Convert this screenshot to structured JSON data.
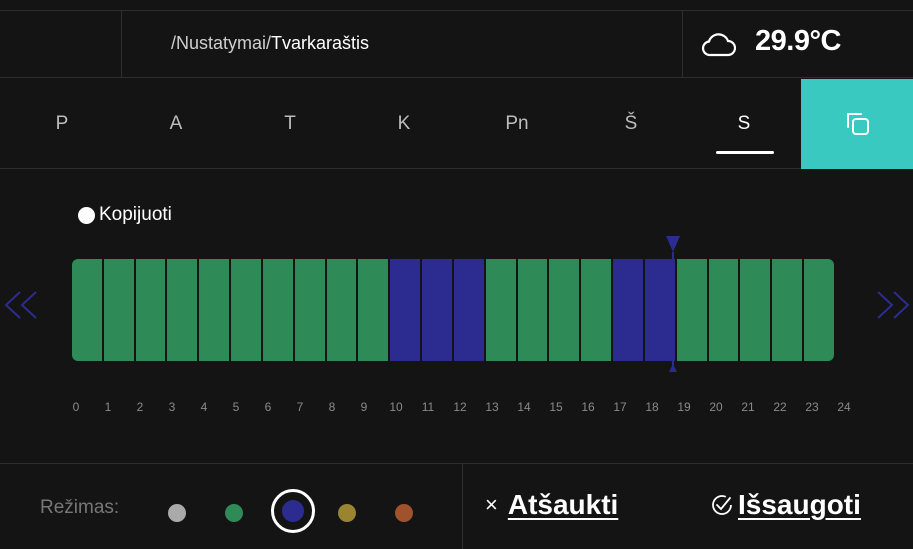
{
  "header": {
    "breadcrumb_path": "/Nustatymai/",
    "breadcrumb_current": "Tvarkaraštis",
    "weather_icon": "cloud-icon",
    "temperature": "29.9°C"
  },
  "days": {
    "items": [
      "P",
      "A",
      "T",
      "K",
      "Pn",
      "Š",
      "S"
    ],
    "active": "S",
    "copy_icon": "copy-icon",
    "copy_color": "#39c9c0"
  },
  "copy_option": {
    "label": "Kopijuoti"
  },
  "schedule": {
    "hours": [
      "0",
      "1",
      "2",
      "3",
      "4",
      "5",
      "6",
      "7",
      "8",
      "9",
      "10",
      "11",
      "12",
      "13",
      "14",
      "15",
      "16",
      "17",
      "18",
      "19",
      "20",
      "21",
      "22",
      "23",
      "24"
    ],
    "slot_colors": {
      "green": "#2e8b57",
      "blue": "#2c2c90"
    },
    "slots": [
      "green",
      "green",
      "green",
      "green",
      "green",
      "green",
      "green",
      "green",
      "green",
      "green",
      "blue",
      "blue",
      "blue",
      "green",
      "green",
      "green",
      "green",
      "blue",
      "blue",
      "green",
      "green",
      "green",
      "green",
      "green"
    ],
    "current_hour_marker": 19,
    "prev_icon": "chevron-double-left-icon",
    "next_icon": "chevron-double-right-icon"
  },
  "bottom": {
    "mode_label": "Režimas:",
    "modes": [
      {
        "name": "gray",
        "color": "#aaaaaa"
      },
      {
        "name": "green",
        "color": "#2e8b57"
      },
      {
        "name": "blue",
        "color": "#2c2c90",
        "selected": true
      },
      {
        "name": "yellow",
        "color": "#9a8430"
      },
      {
        "name": "orange",
        "color": "#a0522d"
      }
    ],
    "cancel_icon": "×",
    "cancel_label": "Atšaukti",
    "save_icon": "check-circle-icon",
    "save_label": "Išsaugoti"
  }
}
